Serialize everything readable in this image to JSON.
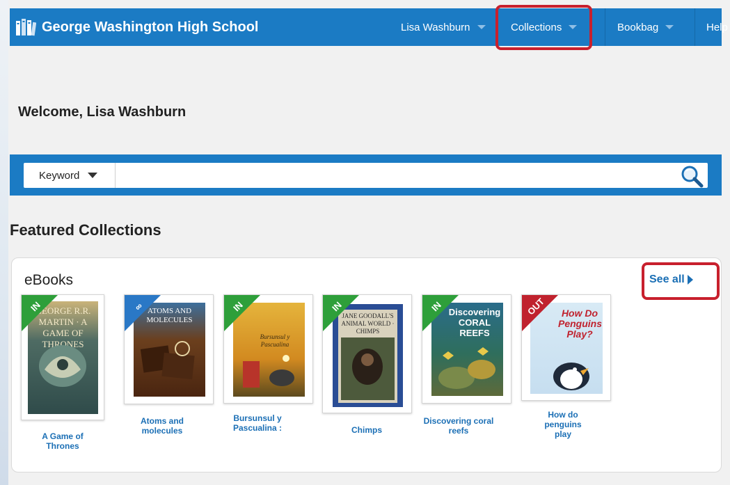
{
  "header": {
    "school_name": "George Washington High School",
    "logo_icon": "books-icon",
    "nav": {
      "user": "Lisa Washburn",
      "collections": "Collections",
      "bookbag": "Bookbag",
      "help": "Help"
    },
    "bar_color": "#1b7bc4"
  },
  "welcome": "Welcome, Lisa Washburn",
  "search": {
    "type_label": "Keyword",
    "value": "",
    "icon": "magnifier-icon"
  },
  "featured": {
    "heading": "Featured Collections",
    "collection": {
      "name": "eBooks",
      "see_all": "See all",
      "books": [
        {
          "title": "A Game of Thrones",
          "badge": "IN",
          "badge_color": "#2e9f3a",
          "cover_color": "#3f5f5c",
          "cover_text": "GEORGE R.R. MARTIN · A GAME OF THRONES"
        },
        {
          "title": "Atoms and molecules",
          "badge": "∞",
          "badge_color": "#2a78c6",
          "cover_color": "#5a3418",
          "cover_text": "ATOMS AND MOLECULES"
        },
        {
          "title": "Bursunsul y Pascualina :",
          "badge": "IN",
          "badge_color": "#2e9f3a",
          "cover_color": "#d79b25",
          "cover_text": "Bursunsul y Pascualina"
        },
        {
          "title": "Chimps",
          "badge": "IN",
          "badge_color": "#2e9f3a",
          "cover_color": "#2a4d95",
          "cover_text": "JANE GOODALL'S ANIMAL WORLD · CHIMPS"
        },
        {
          "title": "Discovering coral reefs",
          "badge": "IN",
          "badge_color": "#2e9f3a",
          "cover_color": "#2e6e5e",
          "cover_text": "Discovering CORAL REEFS"
        },
        {
          "title": "How do penguins play",
          "badge": "OUT",
          "badge_color": "#c0222e",
          "cover_color": "#cfe2ee",
          "cover_text": "How Do Penguins Play?"
        }
      ]
    }
  },
  "highlight_color": "#c8202d"
}
